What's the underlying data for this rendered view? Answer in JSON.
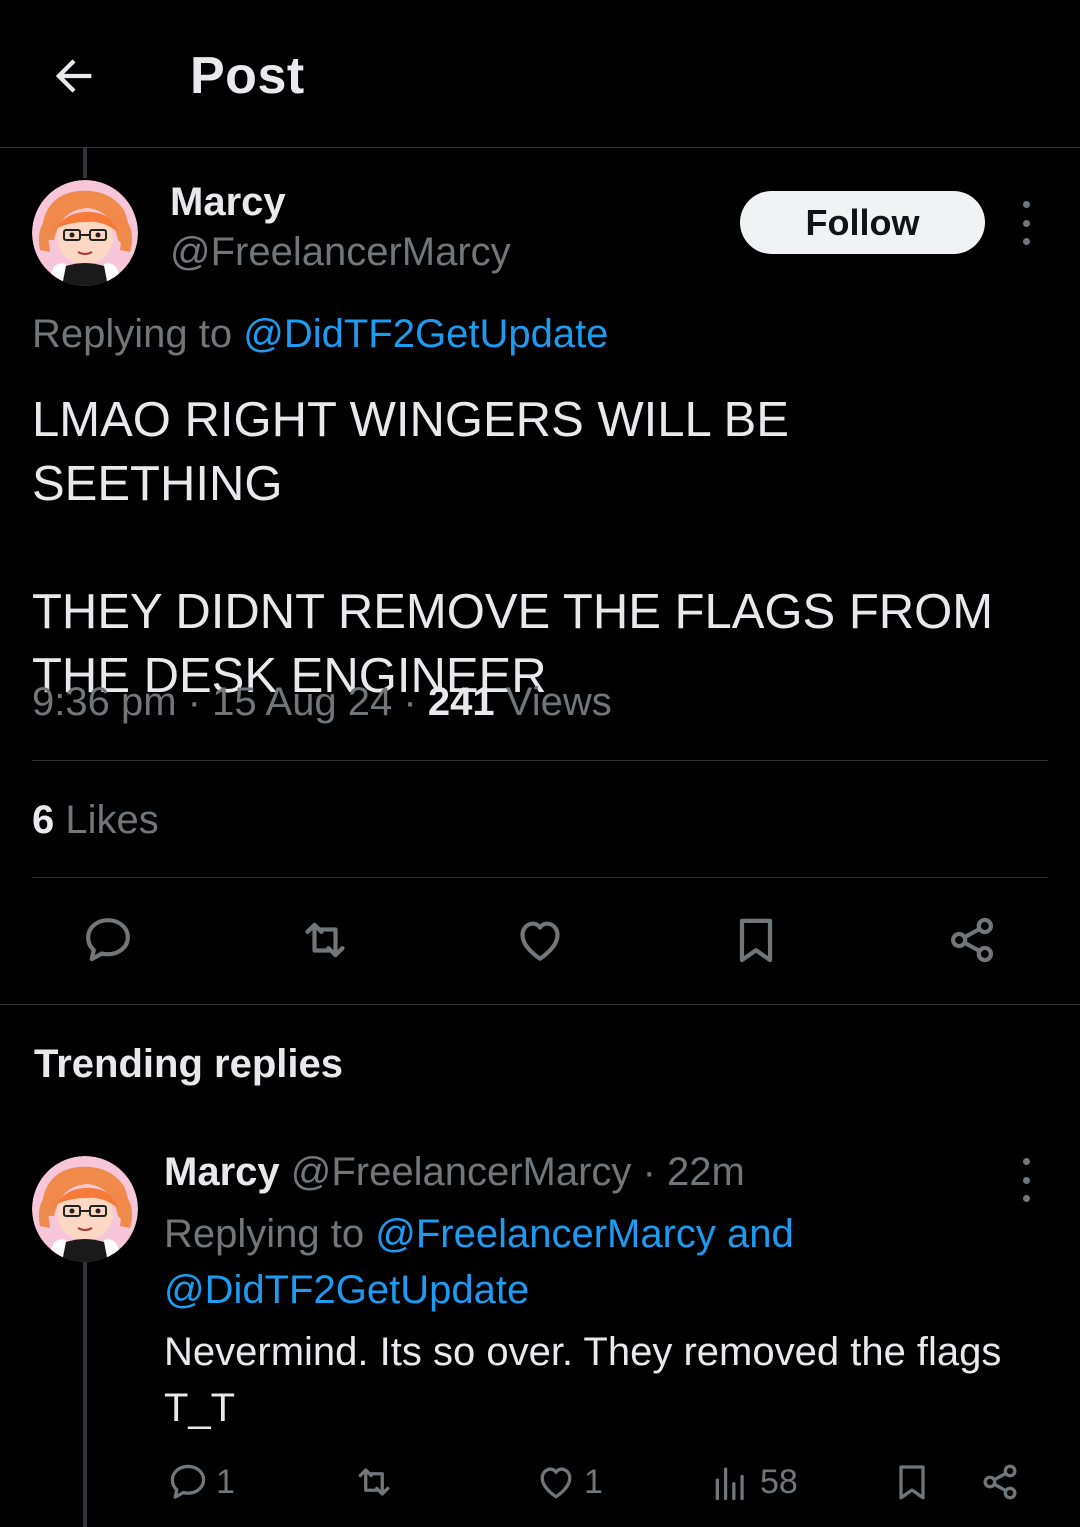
{
  "header": {
    "title": "Post",
    "back_icon": "arrow-left-icon"
  },
  "post": {
    "author": {
      "name": "Marcy",
      "handle": "@FreelancerMarcy"
    },
    "follow_label": "Follow",
    "replying_prefix": "Replying to ",
    "replying_to": "@DidTF2GetUpdate",
    "text_line1": "LMAO RIGHT WINGERS WILL BE SEETHING",
    "text_line2": "THEY DIDNT REMOVE THE FLAGS FROM THE DESK ENGINEER",
    "time": "9:36 pm",
    "date": "15 Aug 24",
    "views_count": "241",
    "views_label": "Views",
    "separator": "·",
    "likes_count": "6",
    "likes_label": "Likes"
  },
  "actions": [
    "reply-icon",
    "repost-icon",
    "like-icon",
    "bookmark-icon",
    "share-icon"
  ],
  "trending": {
    "title": "Trending replies",
    "reply": {
      "name": "Marcy",
      "handle": "@FreelancerMarcy",
      "time_sep": "·",
      "time": "22m",
      "replying_prefix": "Replying to ",
      "replying_to": "@FreelancerMarcy and @DidTF2GetUpdate",
      "text": "Nevermind. Its so over. They removed the flags T_T",
      "reply_count": "1",
      "like_count": "1",
      "views_count": "58"
    }
  },
  "colors": {
    "accent": "#1d9bf0",
    "background": "#000000",
    "secondary_text": "#71767b"
  }
}
